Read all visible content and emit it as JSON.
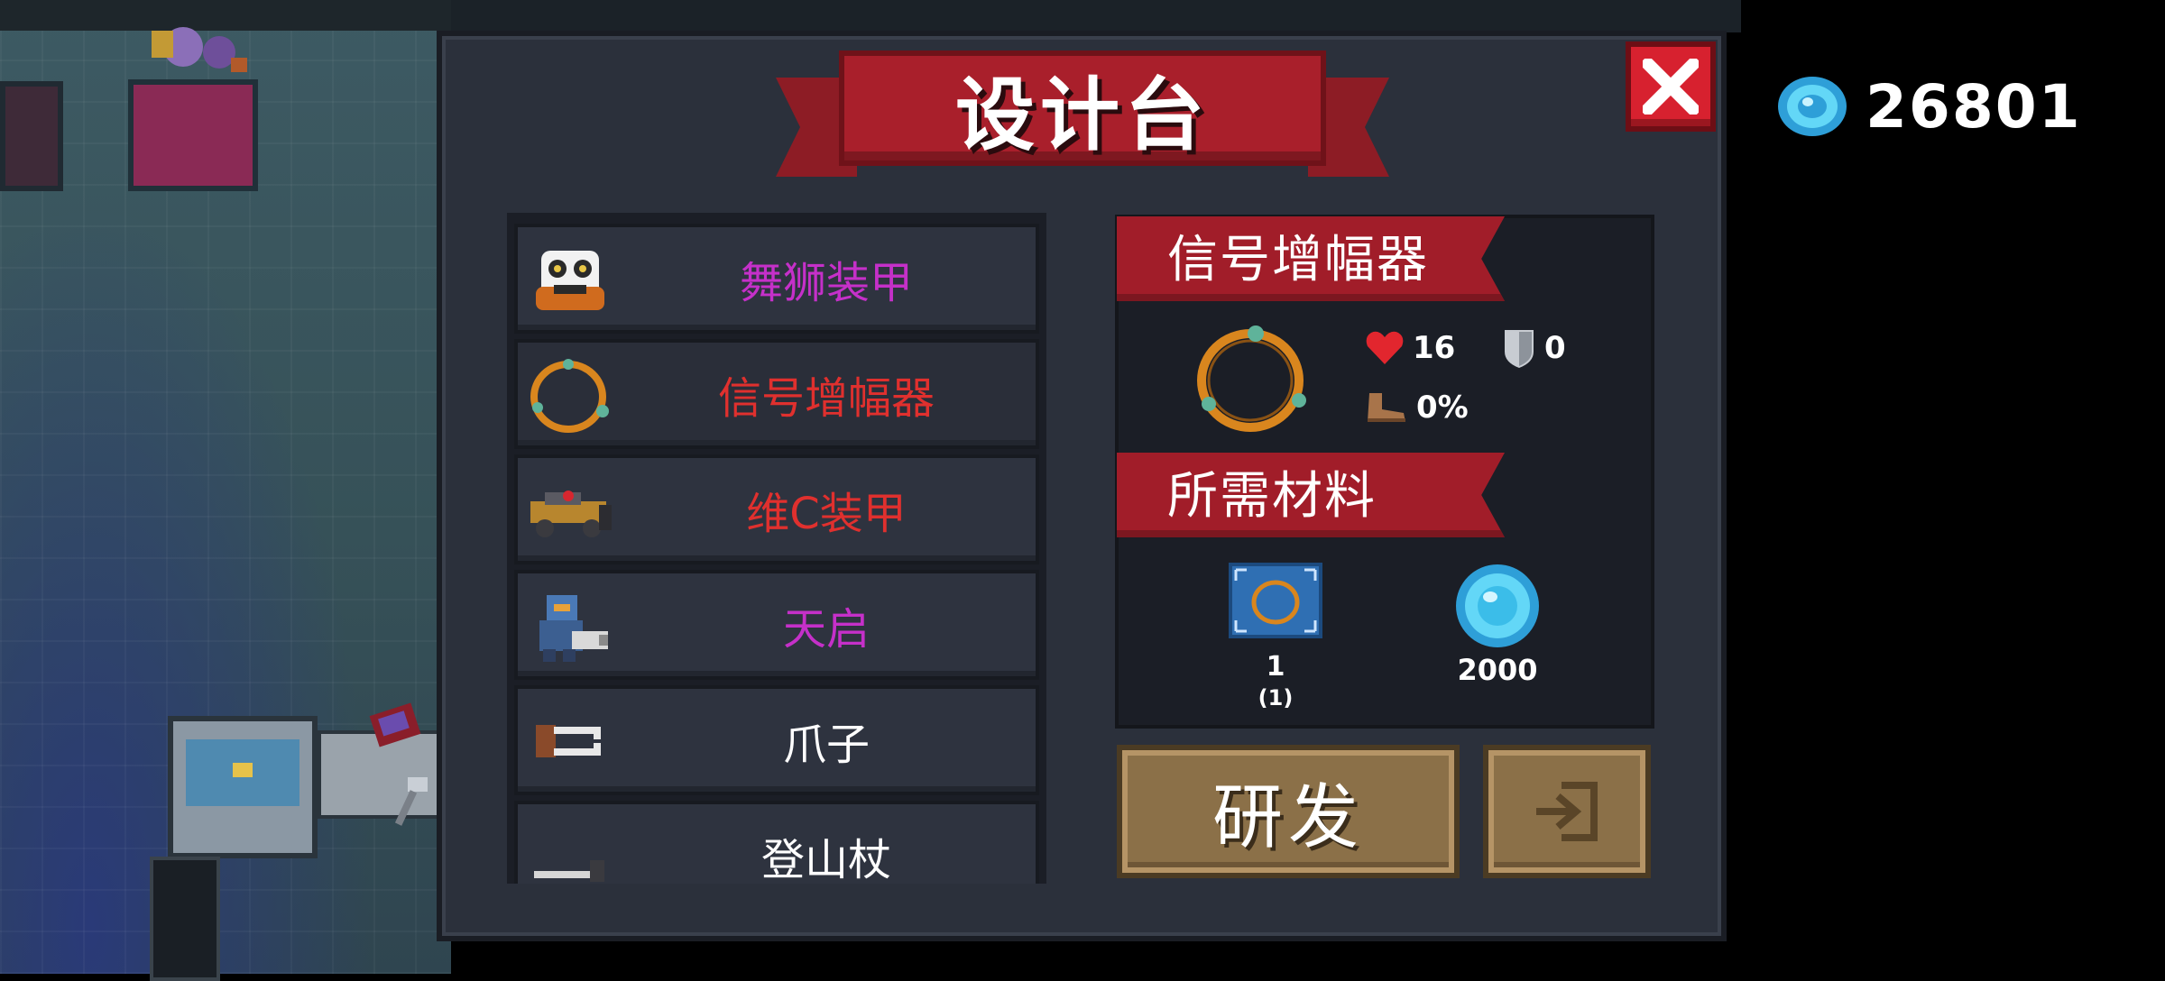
{
  "title": "设计台",
  "currency": {
    "icon": "gem-icon",
    "amount": "26801"
  },
  "blueprints": [
    {
      "name": "舞狮装甲",
      "icon": "lion-dance-armor-icon",
      "color": "#c530c9"
    },
    {
      "name": "信号增幅器",
      "icon": "signal-amplifier-icon",
      "color": "#e0302e",
      "selected": true
    },
    {
      "name": "维C装甲",
      "icon": "vitamin-c-armor-icon",
      "color": "#e0302e"
    },
    {
      "name": "天启",
      "icon": "apocalypse-robot-icon",
      "color": "#c530c9"
    },
    {
      "name": "爪子",
      "icon": "claw-icon",
      "color": "#ffffff"
    },
    {
      "name": "登山杖",
      "icon": "trekking-pole-icon",
      "color": "#ffffff"
    }
  ],
  "detail": {
    "name": "信号增幅器",
    "stats": {
      "health": "16",
      "armor": "0",
      "speed": "0%"
    },
    "materials_title": "所需材料",
    "materials": [
      {
        "icon": "blueprint-icon",
        "value": "1",
        "owned": "(1)"
      },
      {
        "icon": "gem-icon",
        "value": "2000"
      }
    ]
  },
  "buttons": {
    "research": "研发",
    "exit_icon": "exit-icon"
  },
  "colors": {
    "banner": "#a91f2b",
    "panel": "#2b303b",
    "button": "#8b7048",
    "gem": "#3cc8f0"
  }
}
